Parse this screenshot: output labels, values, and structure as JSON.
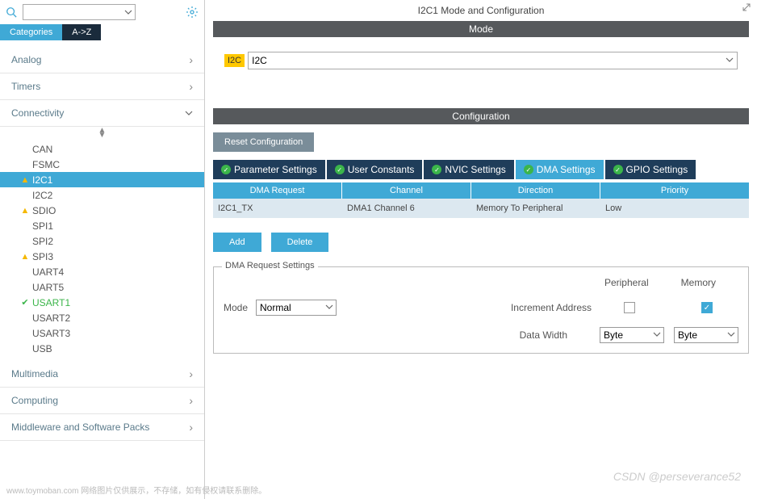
{
  "leftPanel": {
    "viewTabs": {
      "categories": "Categories",
      "az": "A->Z"
    },
    "categories": [
      {
        "name": "Analog",
        "expanded": false
      },
      {
        "name": "Timers",
        "expanded": false
      },
      {
        "name": "Connectivity",
        "expanded": true,
        "hasSort": true
      },
      {
        "name": "Multimedia",
        "expanded": false
      },
      {
        "name": "Computing",
        "expanded": false
      },
      {
        "name": "Middleware and Software Packs",
        "expanded": false
      }
    ],
    "connectivityItems": [
      {
        "label": "CAN",
        "icon": null
      },
      {
        "label": "FSMC",
        "icon": null
      },
      {
        "label": "I2C1",
        "icon": "warn",
        "selected": true
      },
      {
        "label": "I2C2",
        "icon": null
      },
      {
        "label": "SDIO",
        "icon": "warn"
      },
      {
        "label": "SPI1",
        "icon": null
      },
      {
        "label": "SPI2",
        "icon": null
      },
      {
        "label": "SPI3",
        "icon": "warn"
      },
      {
        "label": "UART4",
        "icon": null
      },
      {
        "label": "UART5",
        "icon": null
      },
      {
        "label": "USART1",
        "icon": "ok",
        "green": true
      },
      {
        "label": "USART2",
        "icon": null
      },
      {
        "label": "USART3",
        "icon": null
      },
      {
        "label": "USB",
        "icon": null
      }
    ]
  },
  "rightPanel": {
    "title": "I2C1 Mode and Configuration",
    "modeSection": {
      "header": "Mode",
      "label": "I2C",
      "value": "I2C"
    },
    "configSection": {
      "header": "Configuration",
      "resetBtn": "Reset Configuration",
      "tabs": [
        {
          "label": "Parameter Settings",
          "active": false
        },
        {
          "label": "User Constants",
          "active": false
        },
        {
          "label": "NVIC Settings",
          "active": false
        },
        {
          "label": "DMA Settings",
          "active": true
        },
        {
          "label": "GPIO Settings",
          "active": false
        }
      ],
      "dmaTable": {
        "headers": {
          "req": "DMA Request",
          "ch": "Channel",
          "dir": "Direction",
          "pri": "Priority"
        },
        "rows": [
          {
            "req": "I2C1_TX",
            "ch": "DMA1 Channel 6",
            "dir": "Memory To Peripheral",
            "pri": "Low"
          }
        ]
      },
      "buttons": {
        "add": "Add",
        "delete": "Delete"
      },
      "settings": {
        "legend": "DMA Request Settings",
        "colPeripheral": "Peripheral",
        "colMemory": "Memory",
        "modeLabel": "Mode",
        "modeValue": "Normal",
        "incLabel": "Increment Address",
        "incPeripheral": false,
        "incMemory": true,
        "widthLabel": "Data Width",
        "widthPeripheral": "Byte",
        "widthMemory": "Byte"
      }
    }
  },
  "footer": "www.toymoban.com 网络图片仅供展示，不存储，如有侵权请联系删除。",
  "watermark": "CSDN @perseverance52"
}
